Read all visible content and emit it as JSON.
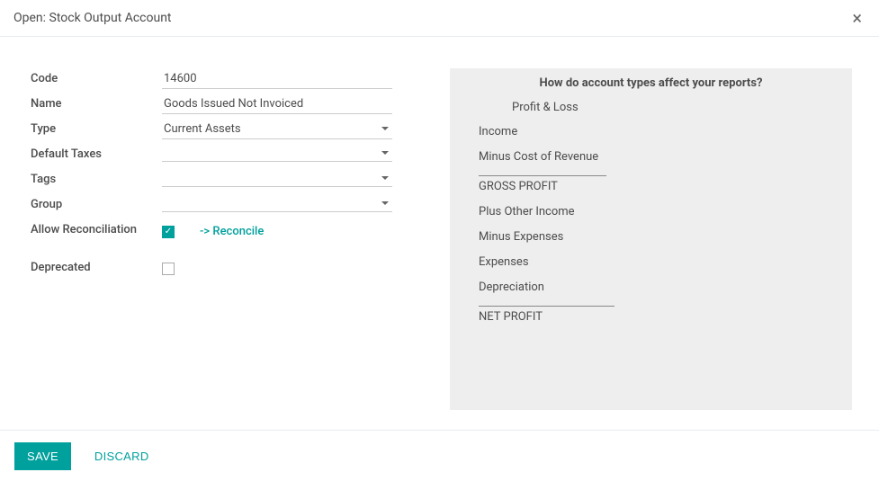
{
  "header": {
    "title": "Open: Stock Output Account",
    "close": "×"
  },
  "form": {
    "code": {
      "label": "Code",
      "value": "14600"
    },
    "name": {
      "label": "Name",
      "value": "Goods Issued Not Invoiced"
    },
    "type": {
      "label": "Type",
      "value": "Current Assets"
    },
    "default_taxes": {
      "label": "Default Taxes",
      "value": ""
    },
    "tags": {
      "label": "Tags",
      "value": ""
    },
    "group": {
      "label": "Group",
      "value": ""
    },
    "allow_reconciliation": {
      "label": "Allow Reconciliation",
      "checked": true,
      "link": "-> Reconcile"
    },
    "deprecated": {
      "label": "Deprecated",
      "checked": false
    }
  },
  "info": {
    "title": "How do account types affect your reports?",
    "pnl": "Profit & Loss",
    "lines": {
      "income": "Income",
      "minus_cor": "Minus Cost of Revenue",
      "gross_profit": "GROSS PROFIT",
      "plus_other": "Plus Other Income",
      "minus_exp": "Minus Expenses",
      "expenses": "Expenses",
      "depreciation": "Depreciation",
      "net_profit": "NET PROFIT"
    }
  },
  "footer": {
    "save": "SAVE",
    "discard": "DISCARD"
  }
}
